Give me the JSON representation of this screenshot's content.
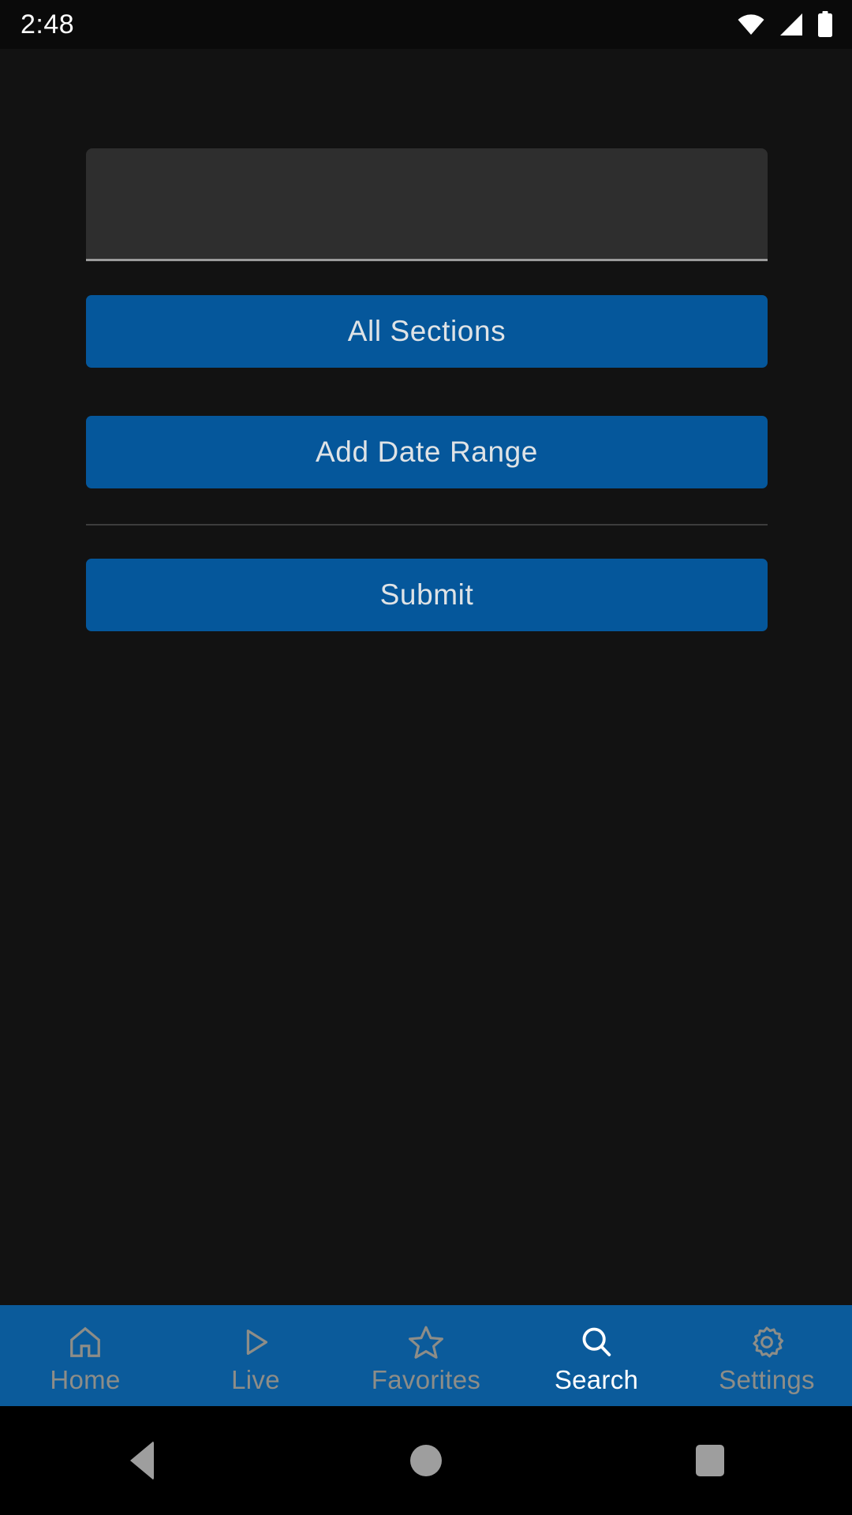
{
  "status_bar": {
    "time": "2:48",
    "icons": [
      "wifi-icon",
      "cellular-signal-icon",
      "battery-icon"
    ]
  },
  "theme": {
    "background": "#121212",
    "status_bar_background": "#0a0a0a",
    "accent_blue": "#05579b",
    "tab_bar_blue": "#0b5b9b",
    "field_background": "#2e2e2e",
    "field_underline": "#9b9b9b",
    "divider": "#3d3d3d",
    "button_text": "#dfe3e6",
    "tab_inactive": "#8d8d88",
    "tab_active": "#ffffff",
    "system_nav_icon": "#9e9e9e"
  },
  "search_form": {
    "query_input": {
      "value": "",
      "placeholder": ""
    },
    "sections_button": "All Sections",
    "date_range_button": "Add Date Range",
    "submit_button": "Submit"
  },
  "tab_bar": {
    "items": [
      {
        "label": "Home",
        "icon": "home-icon",
        "active": false
      },
      {
        "label": "Live",
        "icon": "play-icon",
        "active": false
      },
      {
        "label": "Favorites",
        "icon": "star-icon",
        "active": false
      },
      {
        "label": "Search",
        "icon": "search-icon",
        "active": true
      },
      {
        "label": "Settings",
        "icon": "gear-icon",
        "active": false
      }
    ]
  },
  "system_nav": {
    "back": "back-button",
    "home": "home-button",
    "recents": "recents-button"
  }
}
